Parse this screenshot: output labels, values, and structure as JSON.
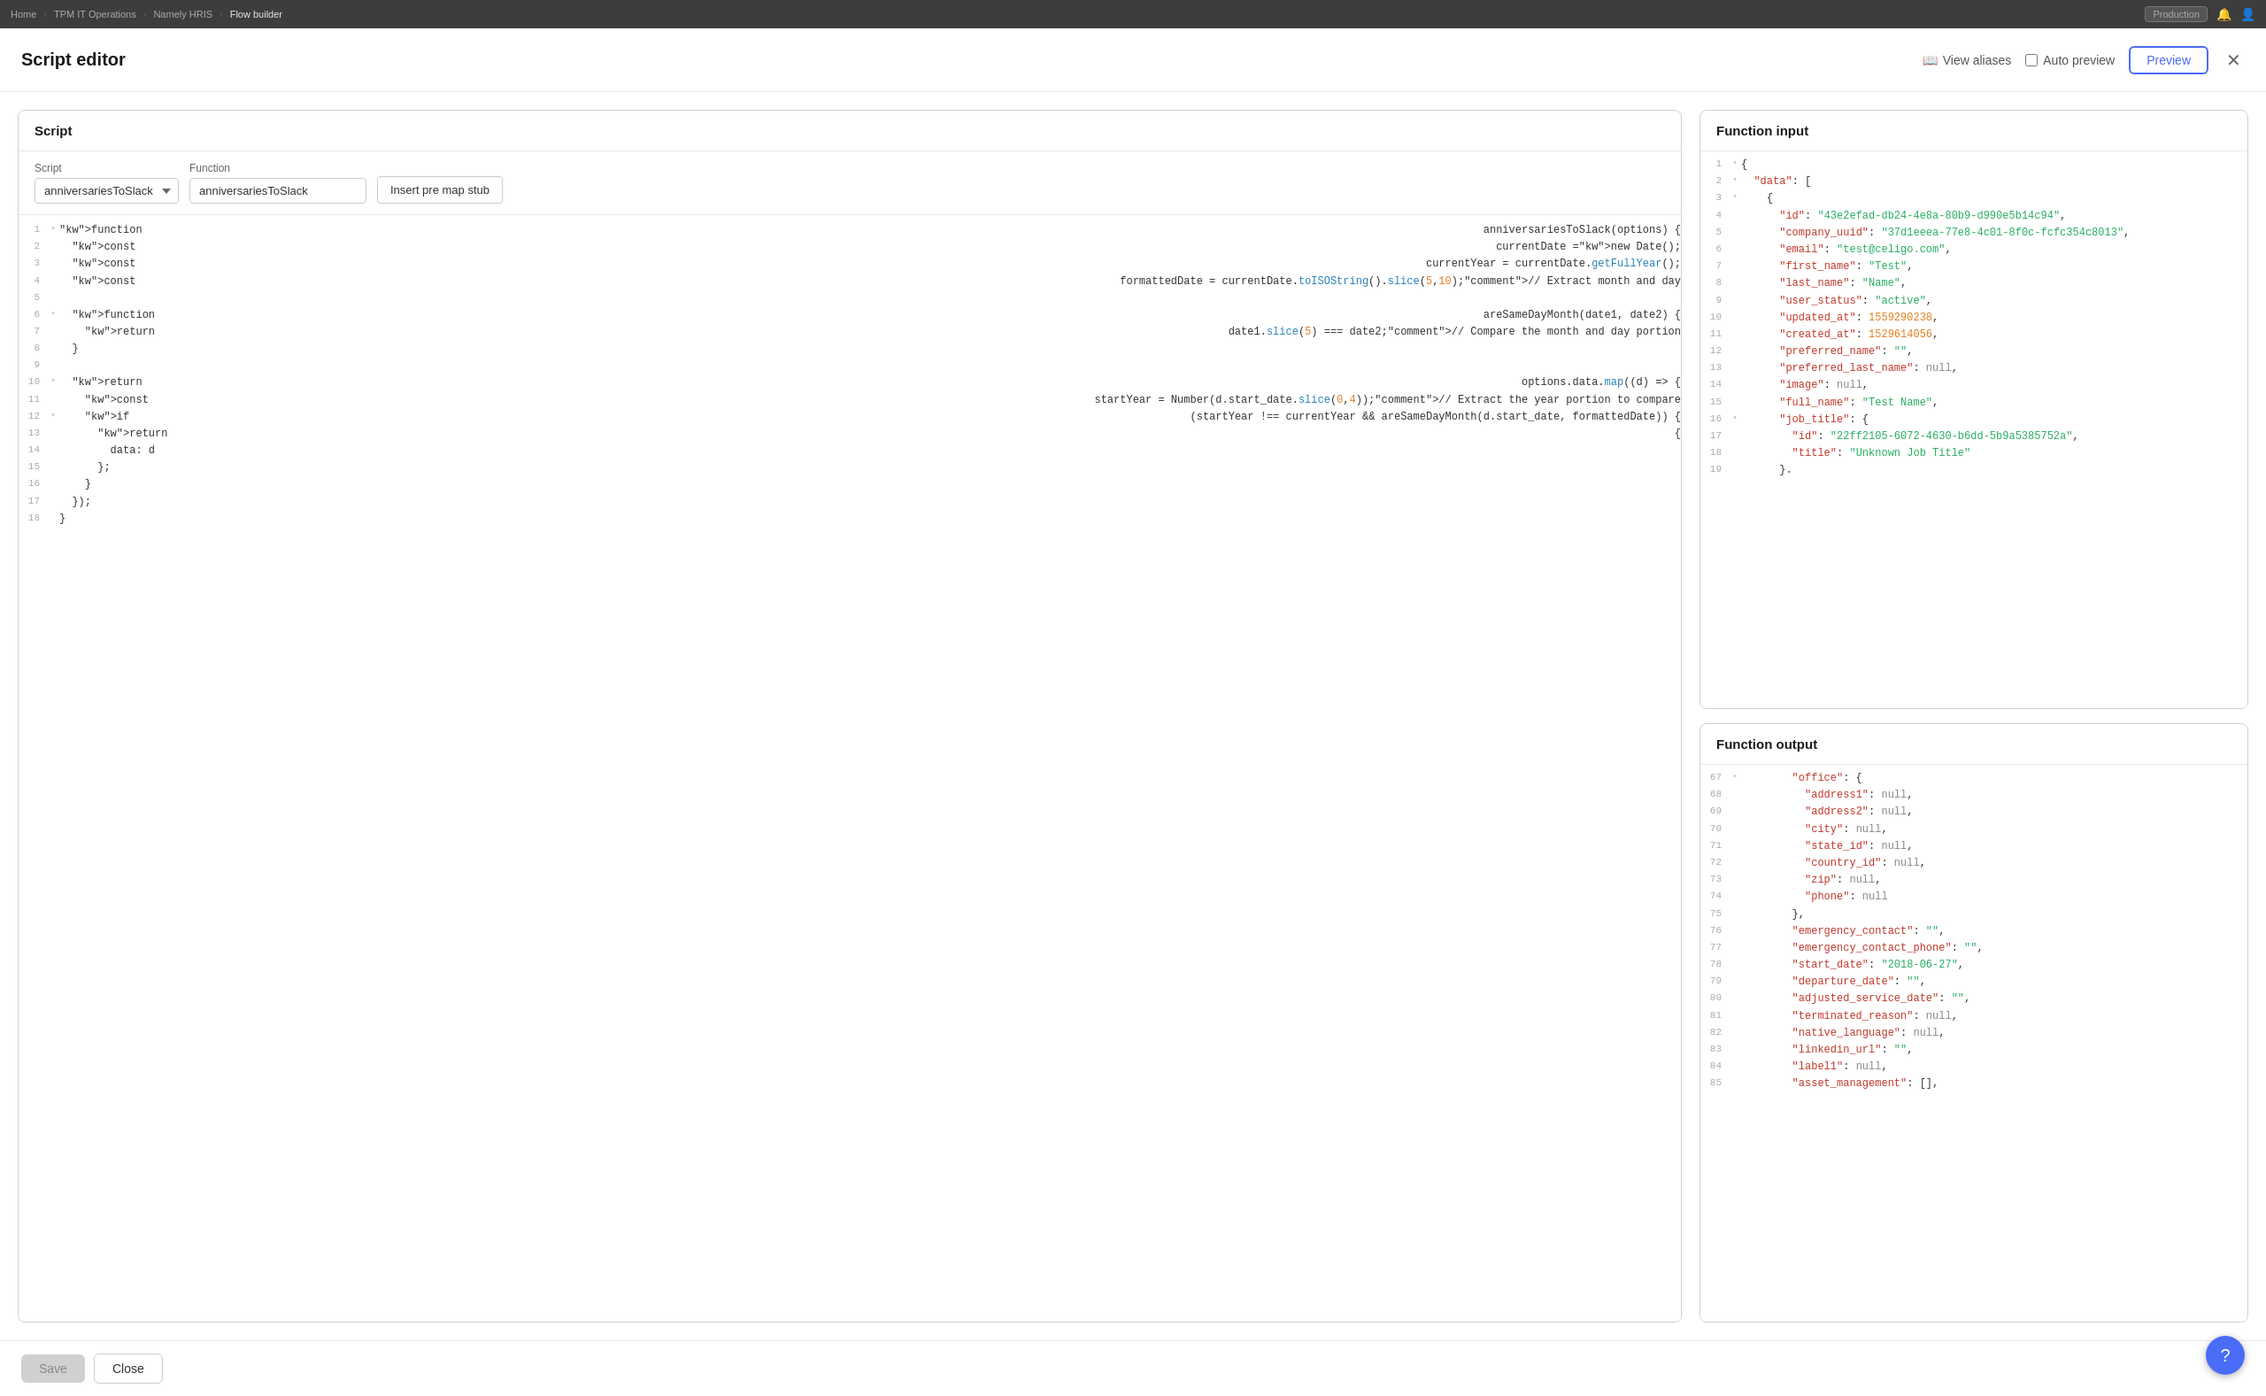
{
  "topnav": {
    "breadcrumbs": [
      "Home",
      "TPM IT Operations",
      "Namely HRIS",
      "Flow builder"
    ],
    "environment": "Production",
    "icons": [
      "bell",
      "user"
    ]
  },
  "header": {
    "title": "Script editor",
    "view_aliases_label": "View aliases",
    "auto_preview_label": "Auto preview",
    "preview_label": "Preview"
  },
  "script_panel": {
    "title": "Script",
    "script_label": "Script",
    "function_label": "Function",
    "script_value": "anniversariesToSlack",
    "function_value": "anniversariesToSlack",
    "insert_stub_label": "Insert pre map stub"
  },
  "code_lines": [
    {
      "num": "1",
      "dot": "•",
      "content": "function anniversariesToSlack(options) {"
    },
    {
      "num": "2",
      "dot": "",
      "content": "  const currentDate = new Date();"
    },
    {
      "num": "3",
      "dot": "",
      "content": "  const currentYear = currentDate.getFullYear();"
    },
    {
      "num": "4",
      "dot": "",
      "content": "  const formattedDate = currentDate.toISOString().slice(5, 10); // Extract month and day"
    },
    {
      "num": "5",
      "dot": "",
      "content": ""
    },
    {
      "num": "6",
      "dot": "•",
      "content": "  function areSameDayMonth(date1, date2) {"
    },
    {
      "num": "7",
      "dot": "",
      "content": "    return date1.slice(5) === date2; // Compare the month and day portion"
    },
    {
      "num": "8",
      "dot": "",
      "content": "  }"
    },
    {
      "num": "9",
      "dot": "",
      "content": ""
    },
    {
      "num": "10",
      "dot": "•",
      "content": "  return options.data.map((d) => {"
    },
    {
      "num": "11",
      "dot": "",
      "content": "    const startYear = Number(d.start_date.slice(0,4)); // Extract the year portion to compare"
    },
    {
      "num": "12",
      "dot": "•",
      "content": "    if (startYear !== currentYear && areSameDayMonth(d.start_date, formattedDate)) {"
    },
    {
      "num": "13",
      "dot": "",
      "content": "      return {"
    },
    {
      "num": "14",
      "dot": "",
      "content": "        data: d"
    },
    {
      "num": "15",
      "dot": "",
      "content": "      };"
    },
    {
      "num": "16",
      "dot": "",
      "content": "    }"
    },
    {
      "num": "17",
      "dot": "",
      "content": "  });"
    },
    {
      "num": "18",
      "dot": "",
      "content": "}"
    }
  ],
  "function_input": {
    "title": "Function input",
    "lines": [
      {
        "num": "1",
        "dot": "•",
        "content": "{"
      },
      {
        "num": "2",
        "dot": "•",
        "content": "  \"data\": ["
      },
      {
        "num": "3",
        "dot": "•",
        "content": "    {"
      },
      {
        "num": "4",
        "dot": "",
        "content": "      \"id\": \"43e2efad-db24-4e8a-80b9-d990e5b14c94\","
      },
      {
        "num": "5",
        "dot": "",
        "content": "      \"company_uuid\": \"37d1eeea-77e8-4c01-8f0c-fcfc354c8013\","
      },
      {
        "num": "6",
        "dot": "",
        "content": "      \"email\": \"test@celigo.com\","
      },
      {
        "num": "7",
        "dot": "",
        "content": "      \"first_name\": \"Test\","
      },
      {
        "num": "8",
        "dot": "",
        "content": "      \"last_name\": \"Name\","
      },
      {
        "num": "9",
        "dot": "",
        "content": "      \"user_status\": \"active\","
      },
      {
        "num": "10",
        "dot": "",
        "content": "      \"updated_at\": 1559290238,"
      },
      {
        "num": "11",
        "dot": "",
        "content": "      \"created_at\": 1529614056,"
      },
      {
        "num": "12",
        "dot": "",
        "content": "      \"preferred_name\": \"\","
      },
      {
        "num": "13",
        "dot": "",
        "content": "      \"preferred_last_name\": null,"
      },
      {
        "num": "14",
        "dot": "",
        "content": "      \"image\": null,"
      },
      {
        "num": "15",
        "dot": "",
        "content": "      \"full_name\": \"Test Name\","
      },
      {
        "num": "16",
        "dot": "•",
        "content": "      \"job_title\": {"
      },
      {
        "num": "17",
        "dot": "",
        "content": "        \"id\": \"22ff2105-6072-4630-b6dd-5b9a5385752a\","
      },
      {
        "num": "18",
        "dot": "",
        "content": "        \"title\": \"Unknown Job Title\""
      },
      {
        "num": "19",
        "dot": "",
        "content": "      }."
      }
    ]
  },
  "function_output": {
    "title": "Function output",
    "lines": [
      {
        "num": "67",
        "dot": "•",
        "content": "        \"office\": {"
      },
      {
        "num": "68",
        "dot": "",
        "content": "          \"address1\": null,"
      },
      {
        "num": "69",
        "dot": "",
        "content": "          \"address2\": null,"
      },
      {
        "num": "70",
        "dot": "",
        "content": "          \"city\": null,"
      },
      {
        "num": "71",
        "dot": "",
        "content": "          \"state_id\": null,"
      },
      {
        "num": "72",
        "dot": "",
        "content": "          \"country_id\": null,"
      },
      {
        "num": "73",
        "dot": "",
        "content": "          \"zip\": null,"
      },
      {
        "num": "74",
        "dot": "",
        "content": "          \"phone\": null"
      },
      {
        "num": "75",
        "dot": "",
        "content": "        },"
      },
      {
        "num": "76",
        "dot": "",
        "content": "        \"emergency_contact\": \"\","
      },
      {
        "num": "77",
        "dot": "",
        "content": "        \"emergency_contact_phone\": \"\","
      },
      {
        "num": "78",
        "dot": "",
        "content": "        \"start_date\": \"2018-06-27\","
      },
      {
        "num": "79",
        "dot": "",
        "content": "        \"departure_date\": \"\","
      },
      {
        "num": "80",
        "dot": "",
        "content": "        \"adjusted_service_date\": \"\","
      },
      {
        "num": "81",
        "dot": "",
        "content": "        \"terminated_reason\": null,"
      },
      {
        "num": "82",
        "dot": "",
        "content": "        \"native_language\": null,"
      },
      {
        "num": "83",
        "dot": "",
        "content": "        \"linkedin_url\": \"\","
      },
      {
        "num": "84",
        "dot": "",
        "content": "        \"label1\": null,"
      },
      {
        "num": "85",
        "dot": "",
        "content": "        \"asset_management\": [],"
      }
    ]
  },
  "footer": {
    "save_label": "Save",
    "close_label": "Close"
  },
  "help": {
    "label": "?"
  }
}
